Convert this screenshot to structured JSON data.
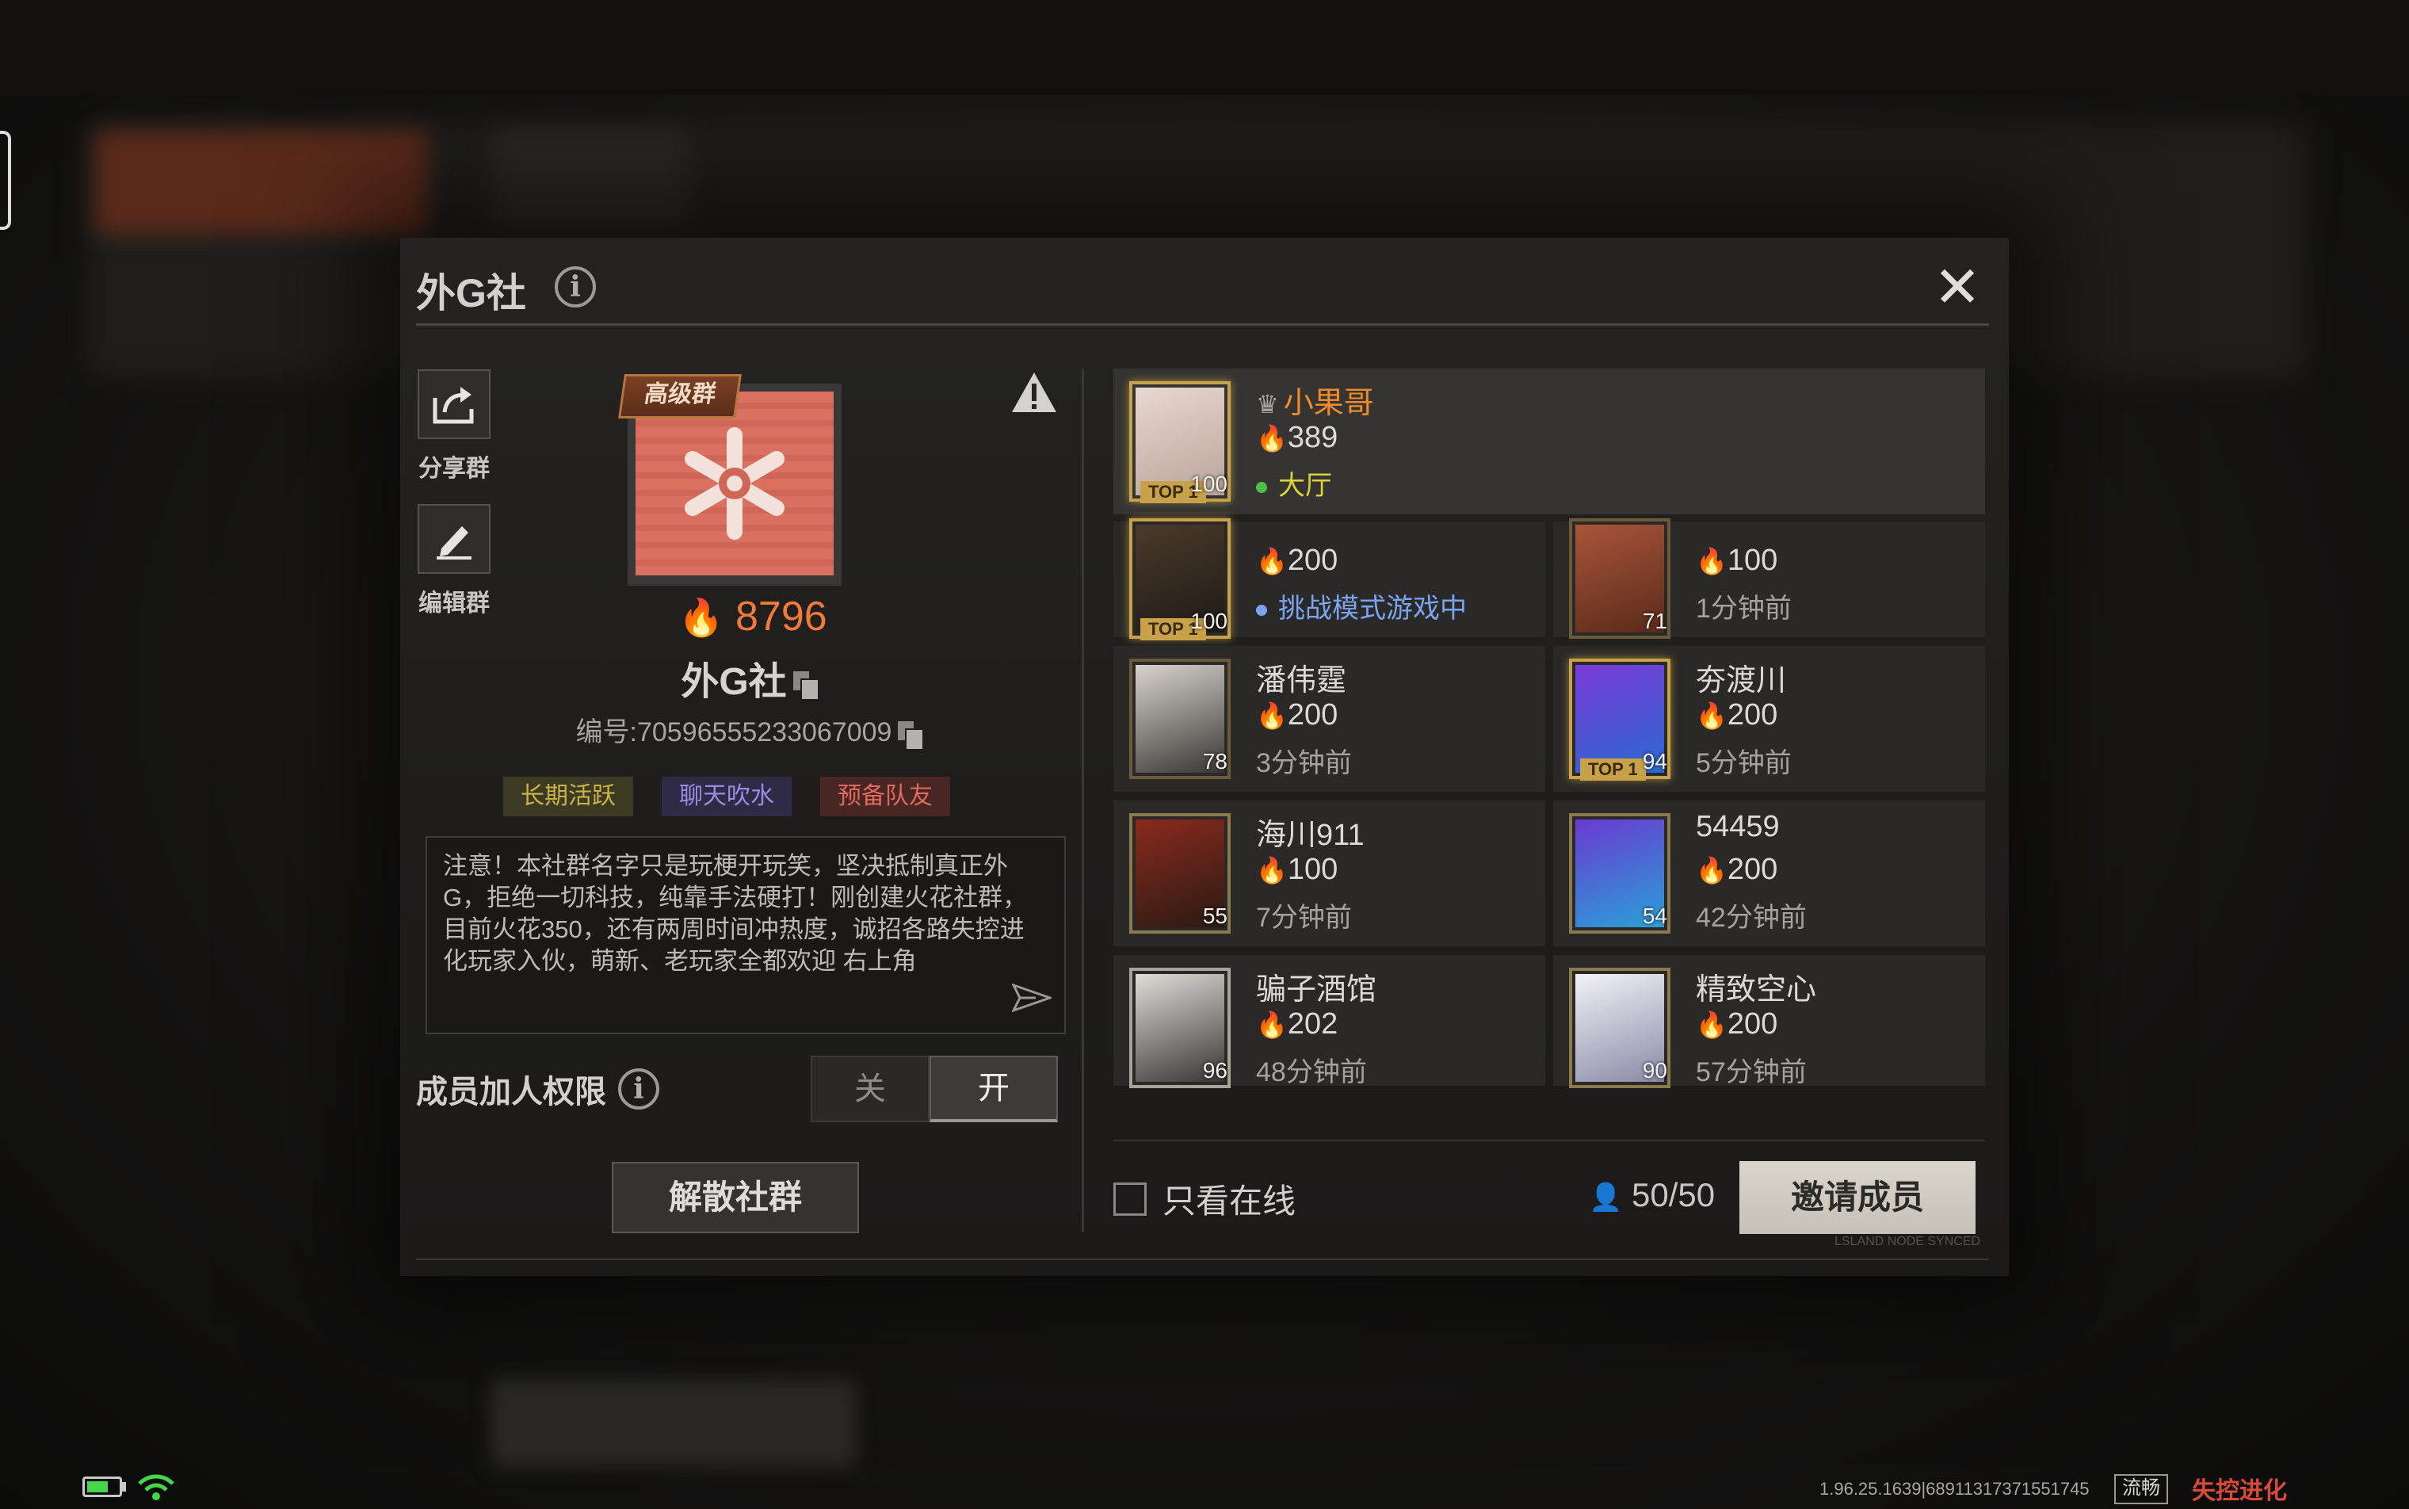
{
  "club": {
    "title": "外G社",
    "name": "外G社",
    "id_text": "编号:70596555233067009",
    "heat": "8796",
    "avatar_badge": "高级群",
    "tags": [
      "长期活跃",
      "聊天吹水",
      "预备队友"
    ],
    "notice": "注意！本社群名字只是玩梗开玩笑，坚决抵制真正外G，拒绝一切科技，纯靠手法硬打！刚创建火花社群，目前火花350，还有两周时间冲热度，诚招各路失控进化玩家入伙，萌新、老玩家全都欢迎 右上角"
  },
  "actions": {
    "share_label": "分享群",
    "edit_label": "编辑群"
  },
  "permission": {
    "label": "成员加人权限",
    "off_label": "关",
    "on_label": "开",
    "state": "on"
  },
  "dissolve_label": "解散社群",
  "members": [
    {
      "name": "小果哥",
      "heat": "389",
      "status": "大厅",
      "level": "100",
      "top": true,
      "owner": true
    },
    {
      "name": "",
      "heat": "200",
      "status": "挑战模式游戏中",
      "level": "100",
      "top": true
    },
    {
      "name": "",
      "heat": "100",
      "status": "1分钟前",
      "level": "71"
    },
    {
      "name": "潘伟霆",
      "heat": "200",
      "status": "3分钟前",
      "level": "78"
    },
    {
      "name": "夯渡川",
      "heat": "200",
      "status": "5分钟前",
      "level": "94",
      "top": true
    },
    {
      "name": "海川911",
      "heat": "100",
      "status": "7分钟前",
      "level": "55"
    },
    {
      "name": "54459",
      "heat": "200",
      "status": "42分钟前",
      "level": "54"
    },
    {
      "name": "骗子酒馆",
      "heat": "202",
      "status": "48分钟前",
      "level": "96"
    },
    {
      "name": "精致空心",
      "heat": "200",
      "status": "57分钟前",
      "level": "90"
    }
  ],
  "top_badge": "TOP 1",
  "footer": {
    "online_only_label": "只看在线",
    "member_count": "50/50",
    "invite_label": "邀请成员",
    "node_text": "LSLAND NODE SYNCED"
  },
  "system": {
    "version": "1.96.25.1639|68911317371551745",
    "fluency": "流畅",
    "logo": "失控进化",
    "battery_level": 0.6
  },
  "colors": {
    "heat": "#f07a3a",
    "owner_name": "#f08a2a",
    "online_dot": "#4ec04a",
    "ingame": "#7aa4f0"
  }
}
